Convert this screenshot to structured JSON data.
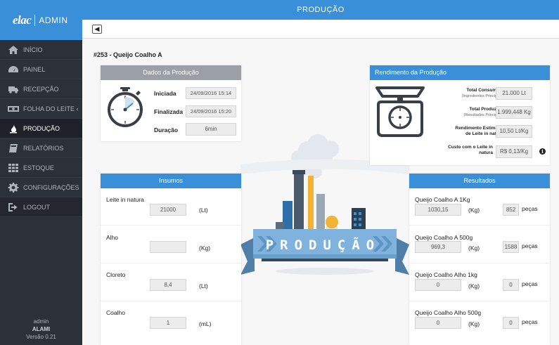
{
  "brand": {
    "logo": "elac",
    "suffix": "ADMIN"
  },
  "header": {
    "title": "PRODUÇÃO"
  },
  "toolbar": {
    "back_symbol": "◀"
  },
  "sidebar": {
    "items": [
      {
        "label": "INÍCIO",
        "icon": "home-icon"
      },
      {
        "label": "PAINEL",
        "icon": "dashboard-icon"
      },
      {
        "label": "RECEPÇÃO",
        "icon": "truck-icon"
      },
      {
        "label": "FOLHA DO LEITE ‹",
        "icon": "money-icon"
      },
      {
        "label": "PRODUÇÃO",
        "icon": "drop-icon"
      },
      {
        "label": "RELATÓRIOS",
        "icon": "book-icon"
      },
      {
        "label": "ESTOQUE",
        "icon": "grid-icon"
      },
      {
        "label": "CONFIGURAÇÕES",
        "icon": "gear-icon"
      },
      {
        "label": "LOGOUT",
        "icon": "logout-icon"
      }
    ],
    "user": {
      "role": "admin",
      "name": "ALAMI",
      "version": "Versão 0.21"
    }
  },
  "page": {
    "title": "#253 - Queijo Coalho A"
  },
  "dados": {
    "title": "Dados da Produção",
    "iniciada_label": "Iniciada",
    "iniciada": "24/09/2016 15:14",
    "finalizada_label": "Finalizada",
    "finalizada": "24/09/2016 15:20",
    "duracao_label": "Duração",
    "duracao": "6min"
  },
  "rendimento": {
    "title": "Rendimento da Produção",
    "total_consumido_label": "Total Consumido",
    "total_consumido_sub": "(Ingredientes Principais)",
    "total_consumido": "21.000 Lt",
    "total_produzido_label": "Total Produzido",
    "total_produzido_sub": "(Resultados Principais)",
    "total_produzido": "1.999,448 Kg",
    "rend_label_1": "Rendimento Estimado",
    "rend_label_2": "de Leite in natura",
    "rendimento_estimado": "10,50 Lt/Kg",
    "custo_label_1": "Custo com o Leite in",
    "custo_label_2": "natura",
    "custo": "R$ 0,13/Kg",
    "info_symbol": "i"
  },
  "insumos": {
    "title": "Insumos",
    "items": [
      {
        "name": "Leite in natura",
        "value": "21000",
        "unit": "(Lt)"
      },
      {
        "name": "Alho",
        "value": "",
        "unit": "(Kg)"
      },
      {
        "name": "Cloreto",
        "value": "8,4",
        "unit": "(Lt)"
      },
      {
        "name": "Coalho",
        "value": "1",
        "unit": "(mL)"
      }
    ]
  },
  "resultados": {
    "title": "Resultados",
    "pecas_label": "peças",
    "items": [
      {
        "name": "Queijo Coalho A 1Kg",
        "value": "1030,15",
        "unit": "(Kg)",
        "pecas": "852"
      },
      {
        "name": "Queijo Coalho A 500g",
        "value": "969,3",
        "unit": "(Kg)",
        "pecas": "1588"
      },
      {
        "name": "Queijo Coalho Alho 1kg",
        "value": "0",
        "unit": "(Kg)",
        "pecas": "0"
      },
      {
        "name": "Queijo Coalho Alho 500g",
        "value": "0",
        "unit": "(Kg)",
        "pecas": "0"
      }
    ]
  },
  "banner": {
    "text": "PRODUÇÃO"
  },
  "colors": {
    "primary": "#3a8fd9",
    "sidebar": "#2c3139",
    "card_head_gray": "#9aa0a6"
  }
}
